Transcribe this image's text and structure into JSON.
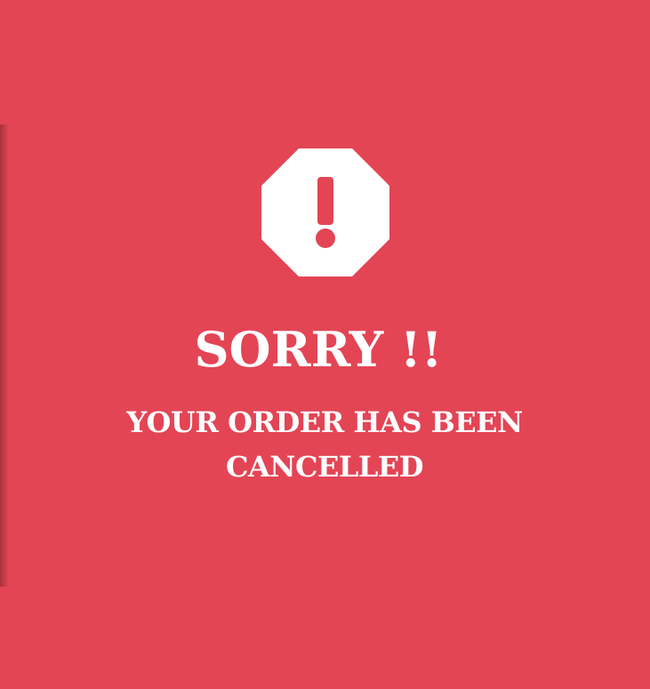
{
  "colors": {
    "background": "#e34555",
    "foreground": "#ffffff"
  },
  "status": {
    "icon": "exclamation-octagon-icon",
    "title": "SORRY !!",
    "message": "YOUR ORDER HAS BEEN CANCELLED"
  }
}
